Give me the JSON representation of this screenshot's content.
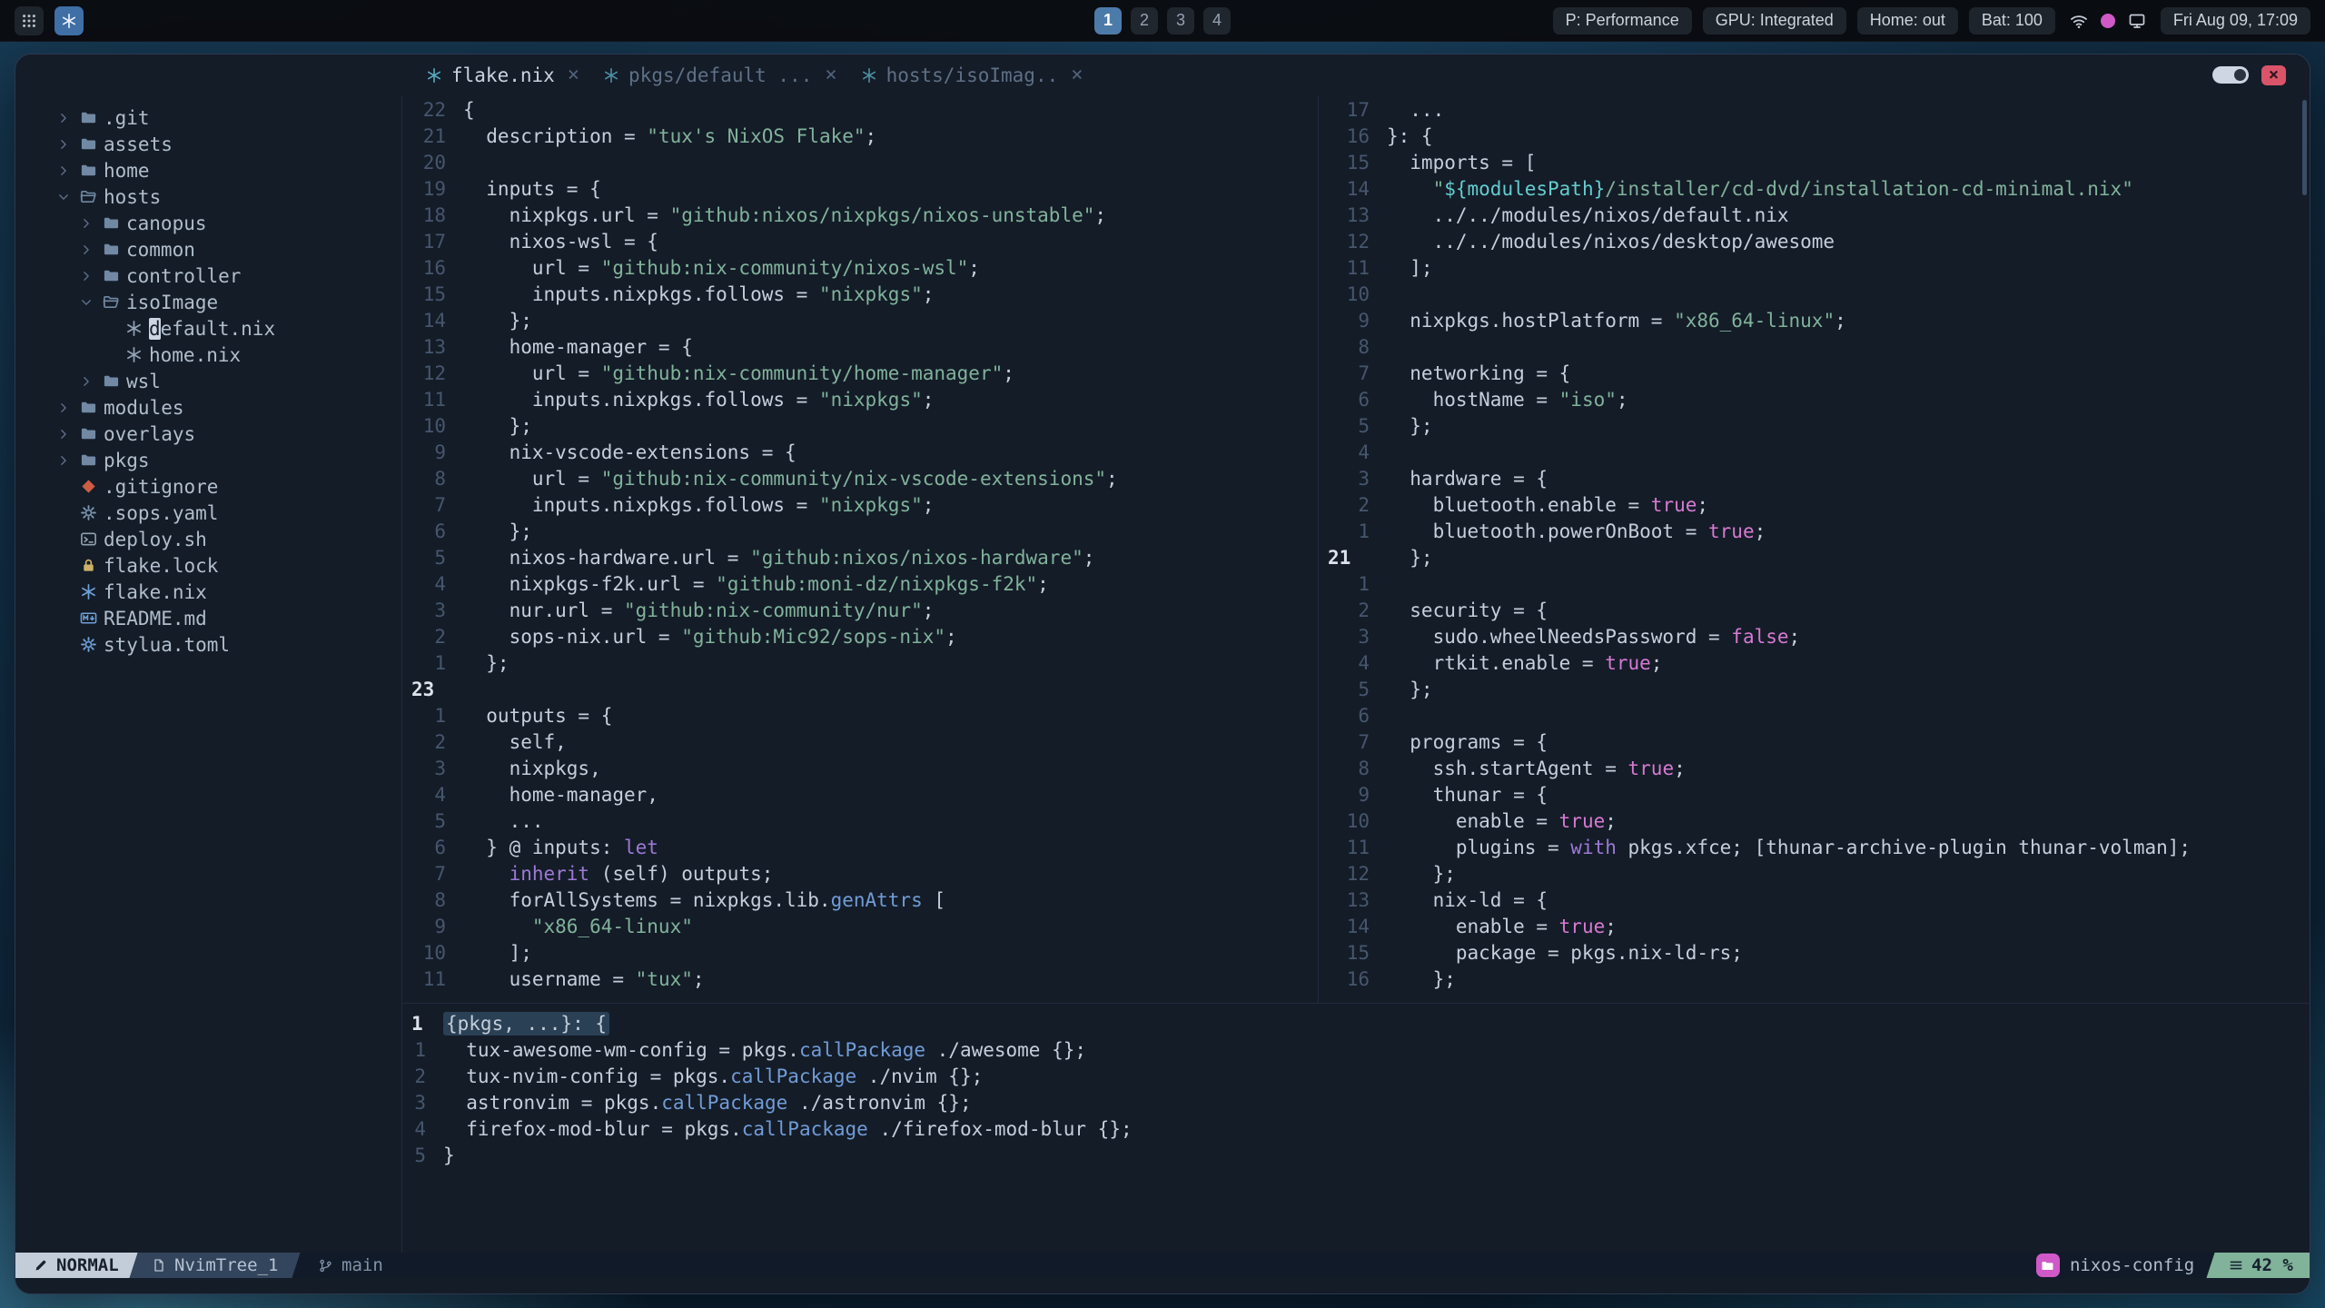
{
  "topbar": {
    "workspaces": [
      "1",
      "2",
      "3",
      "4"
    ],
    "active_workspace": "1",
    "badges": [
      "P: Performance",
      "GPU: Integrated",
      "Home: out",
      "Bat: 100"
    ],
    "clock": "Fri Aug 09, 17:09"
  },
  "colors": {
    "accent_blue": "#719cd6",
    "string_green": "#81b29a",
    "boolean_pink": "#d67ad2",
    "keyword_magenta": "#9d79d6",
    "interp_cyan": "#63cdcf",
    "project_pink": "#cf59c6",
    "scroll_green": "#81b29a",
    "close_red": "#d95468"
  },
  "window": {
    "active_tab": 0,
    "tabs": [
      {
        "label": "flake.nix"
      },
      {
        "label": "pkgs/default ..."
      },
      {
        "label": "hosts/isoImag.."
      }
    ],
    "tree": [
      {
        "label": ".git",
        "depth": 0,
        "chev": "right",
        "icon": "folder"
      },
      {
        "label": "assets",
        "depth": 0,
        "chev": "right",
        "icon": "folder"
      },
      {
        "label": "home",
        "depth": 0,
        "chev": "right",
        "icon": "folder"
      },
      {
        "label": "hosts",
        "depth": 0,
        "chev": "down",
        "icon": "folder-open"
      },
      {
        "label": "canopus",
        "depth": 1,
        "chev": "right",
        "icon": "folder"
      },
      {
        "label": "common",
        "depth": 1,
        "chev": "right",
        "icon": "folder"
      },
      {
        "label": "controller",
        "depth": 1,
        "chev": "right",
        "icon": "folder"
      },
      {
        "label": "isoImage",
        "depth": 1,
        "chev": "down",
        "icon": "folder-open"
      },
      {
        "label": "default.nix",
        "depth": 2,
        "chev": null,
        "icon": "nix",
        "cursor": true
      },
      {
        "label": "home.nix",
        "depth": 2,
        "chev": null,
        "icon": "nix"
      },
      {
        "label": "wsl",
        "depth": 1,
        "chev": "right",
        "icon": "folder"
      },
      {
        "label": "modules",
        "depth": 0,
        "chev": "right",
        "icon": "folder"
      },
      {
        "label": "overlays",
        "depth": 0,
        "chev": "right",
        "icon": "folder"
      },
      {
        "label": "pkgs",
        "depth": 0,
        "chev": "right",
        "icon": "folder"
      },
      {
        "label": ".gitignore",
        "depth": 0,
        "chev": null,
        "icon": "diamond"
      },
      {
        "label": ".sops.yaml",
        "depth": 0,
        "chev": null,
        "icon": "gear"
      },
      {
        "label": "deploy.sh",
        "depth": 0,
        "chev": null,
        "icon": "shell"
      },
      {
        "label": "flake.lock",
        "depth": 0,
        "chev": null,
        "icon": "lock"
      },
      {
        "label": "flake.nix",
        "depth": 0,
        "chev": null,
        "icon": "nix-blue"
      },
      {
        "label": "README.md",
        "depth": 0,
        "chev": null,
        "icon": "md"
      },
      {
        "label": "stylua.toml",
        "depth": 0,
        "chev": null,
        "icon": "gear-blue"
      }
    ],
    "panes": {
      "flake": {
        "lines": [
          {
            "n": "22",
            "t": "{"
          },
          {
            "n": "21",
            "t": "  description = \"tux's NixOS Flake\";"
          },
          {
            "n": "20",
            "t": ""
          },
          {
            "n": "19",
            "t": "  inputs = {"
          },
          {
            "n": "18",
            "t": "    nixpkgs.url = \"github:nixos/nixpkgs/nixos-unstable\";"
          },
          {
            "n": "17",
            "t": "    nixos-wsl = {"
          },
          {
            "n": "16",
            "t": "      url = \"github:nix-community/nixos-wsl\";"
          },
          {
            "n": "15",
            "t": "      inputs.nixpkgs.follows = \"nixpkgs\";"
          },
          {
            "n": "14",
            "t": "    };"
          },
          {
            "n": "13",
            "t": "    home-manager = {"
          },
          {
            "n": "12",
            "t": "      url = \"github:nix-community/home-manager\";"
          },
          {
            "n": "11",
            "t": "      inputs.nixpkgs.follows = \"nixpkgs\";"
          },
          {
            "n": "10",
            "t": "    };"
          },
          {
            "n": "9",
            "t": "    nix-vscode-extensions = {"
          },
          {
            "n": "8",
            "t": "      url = \"github:nix-community/nix-vscode-extensions\";"
          },
          {
            "n": "7",
            "t": "      inputs.nixpkgs.follows = \"nixpkgs\";"
          },
          {
            "n": "6",
            "t": "    };"
          },
          {
            "n": "5",
            "t": "    nixos-hardware.url = \"github:nixos/nixos-hardware\";"
          },
          {
            "n": "4",
            "t": "    nixpkgs-f2k.url = \"github:moni-dz/nixpkgs-f2k\";"
          },
          {
            "n": "3",
            "t": "    nur.url = \"github:nix-community/nur\";"
          },
          {
            "n": "2",
            "t": "    sops-nix.url = \"github:Mic92/sops-nix\";"
          },
          {
            "n": "1",
            "t": "  };"
          },
          {
            "n": "23",
            "t": "",
            "cur": true
          },
          {
            "n": "1",
            "t": "  outputs = {"
          },
          {
            "n": "2",
            "t": "    self,"
          },
          {
            "n": "3",
            "t": "    nixpkgs,"
          },
          {
            "n": "4",
            "t": "    home-manager,"
          },
          {
            "n": "5",
            "t": "    ..."
          },
          {
            "n": "6",
            "t": "  } @ inputs: let"
          },
          {
            "n": "7",
            "t": "    inherit (self) outputs;"
          },
          {
            "n": "8",
            "t": "    forAllSystems = nixpkgs.lib.genAttrs ["
          },
          {
            "n": "9",
            "t": "      \"x86_64-linux\""
          },
          {
            "n": "10",
            "t": "    ];"
          },
          {
            "n": "11",
            "t": "    username = \"tux\";"
          }
        ]
      },
      "iso": {
        "lines": [
          {
            "n": "17",
            "t": "  ..."
          },
          {
            "n": "16",
            "t": "}: {"
          },
          {
            "n": "15",
            "t": "  imports = ["
          },
          {
            "n": "14",
            "t": "    \"${modulesPath}/installer/cd-dvd/installation-cd-minimal.nix\""
          },
          {
            "n": "13",
            "t": "    ../../modules/nixos/default.nix"
          },
          {
            "n": "12",
            "t": "    ../../modules/nixos/desktop/awesome"
          },
          {
            "n": "11",
            "t": "  ];"
          },
          {
            "n": "10",
            "t": ""
          },
          {
            "n": "9",
            "t": "  nixpkgs.hostPlatform = \"x86_64-linux\";"
          },
          {
            "n": "8",
            "t": ""
          },
          {
            "n": "7",
            "t": "  networking = {"
          },
          {
            "n": "6",
            "t": "    hostName = \"iso\";"
          },
          {
            "n": "5",
            "t": "  };"
          },
          {
            "n": "4",
            "t": ""
          },
          {
            "n": "3",
            "t": "  hardware = {"
          },
          {
            "n": "2",
            "t": "    bluetooth.enable = true;"
          },
          {
            "n": "1",
            "t": "    bluetooth.powerOnBoot = true;"
          },
          {
            "n": "21",
            "t": "  };",
            "cur": true
          },
          {
            "n": "1",
            "t": ""
          },
          {
            "n": "2",
            "t": "  security = {"
          },
          {
            "n": "3",
            "t": "    sudo.wheelNeedsPassword = false;"
          },
          {
            "n": "4",
            "t": "    rtkit.enable = true;"
          },
          {
            "n": "5",
            "t": "  };"
          },
          {
            "n": "6",
            "t": ""
          },
          {
            "n": "7",
            "t": "  programs = {"
          },
          {
            "n": "8",
            "t": "    ssh.startAgent = true;"
          },
          {
            "n": "9",
            "t": "    thunar = {"
          },
          {
            "n": "10",
            "t": "      enable = true;"
          },
          {
            "n": "11",
            "t": "      plugins = with pkgs.xfce; [thunar-archive-plugin thunar-volman];"
          },
          {
            "n": "12",
            "t": "    };"
          },
          {
            "n": "13",
            "t": "    nix-ld = {"
          },
          {
            "n": "14",
            "t": "      enable = true;"
          },
          {
            "n": "15",
            "t": "      package = pkgs.nix-ld-rs;"
          },
          {
            "n": "16",
            "t": "    };"
          }
        ]
      },
      "pkgs": {
        "lines": [
          {
            "n": "1",
            "t": "{pkgs, ...}: {",
            "cur": true,
            "hl": true
          },
          {
            "n": "1",
            "t": "  tux-awesome-wm-config = pkgs.callPackage ./awesome {};"
          },
          {
            "n": "2",
            "t": "  tux-nvim-config = pkgs.callPackage ./nvim {};"
          },
          {
            "n": "3",
            "t": "  astronvim = pkgs.callPackage ./astronvim {};"
          },
          {
            "n": "4",
            "t": "  firefox-mod-blur = pkgs.callPackage ./firefox-mod-blur {};"
          },
          {
            "n": "5",
            "t": "}"
          }
        ]
      }
    },
    "statusline": {
      "mode": "NORMAL",
      "buffer": "NvimTree_1",
      "branch": "main",
      "project": "nixos-config",
      "scroll": "42 %"
    }
  }
}
